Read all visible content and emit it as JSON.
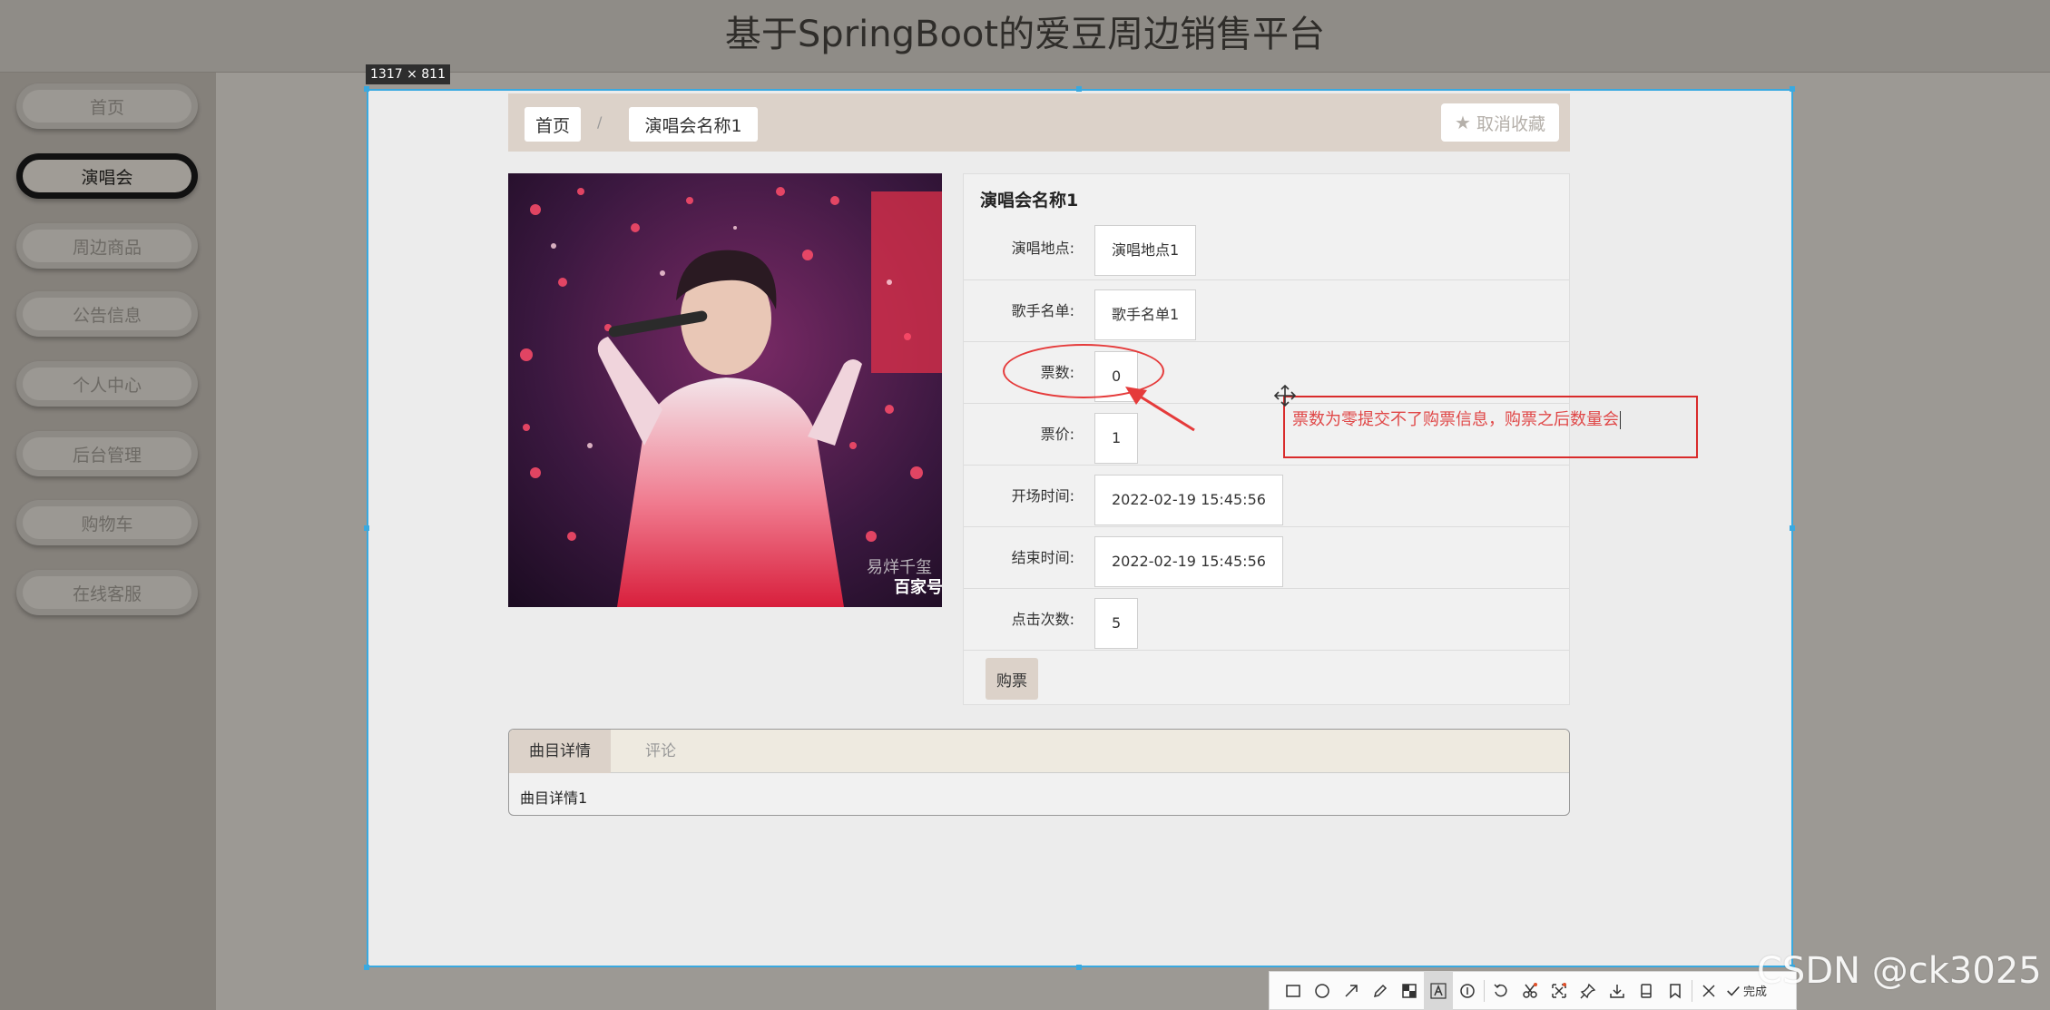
{
  "app": {
    "title": "基于SpringBoot的爱豆周边销售平台"
  },
  "sidebar": {
    "items": [
      {
        "label": "首页",
        "active": false
      },
      {
        "label": "演唱会",
        "active": true
      },
      {
        "label": "周边商品",
        "active": false
      },
      {
        "label": "公告信息",
        "active": false
      },
      {
        "label": "个人中心",
        "active": false
      },
      {
        "label": "后台管理",
        "active": false
      },
      {
        "label": "购物车",
        "active": false
      },
      {
        "label": "在线客服",
        "active": false
      }
    ]
  },
  "capture": {
    "size_label": "1317 × 811",
    "border_color": "#39a9e0"
  },
  "breadcrumb": {
    "home": "首页",
    "separator": "/",
    "current": "演唱会名称1",
    "favorite_label": "取消收藏"
  },
  "detail": {
    "title": "演唱会名称1",
    "fields": [
      {
        "label": "演唱地点:",
        "value": "演唱地点1"
      },
      {
        "label": "歌手名单:",
        "value": "歌手名单1"
      },
      {
        "label": "票数:",
        "value": "0"
      },
      {
        "label": "票价:",
        "value": "1"
      },
      {
        "label": "开场时间:",
        "value": "2022-02-19 15:45:56"
      },
      {
        "label": "结束时间:",
        "value": "2022-02-19 15:45:56"
      },
      {
        "label": "点击次数:",
        "value": "5"
      }
    ],
    "buy_label": "购票"
  },
  "annotation": {
    "text": "票数为零提交不了购票信息，购票之后数量会",
    "color": "#e04848"
  },
  "tabs": {
    "items": [
      "曲目详情",
      "评论"
    ],
    "active_content": "曲目详情1"
  },
  "toolbar": {
    "tools": [
      "rectangle-icon",
      "ellipse-icon",
      "arrow-icon",
      "pencil-icon",
      "mosaic-icon",
      "text-icon",
      "number-icon",
      "undo-icon",
      "ocr-icon",
      "translate-icon",
      "pin-icon",
      "download-icon",
      "save-icon",
      "bookmark-icon",
      "cancel-icon",
      "confirm-icon"
    ],
    "done_label": "完成"
  },
  "watermark": "CSDN @ck3025",
  "colors": {
    "accent": "#dcd2c9",
    "annotation": "#d92b2b"
  }
}
